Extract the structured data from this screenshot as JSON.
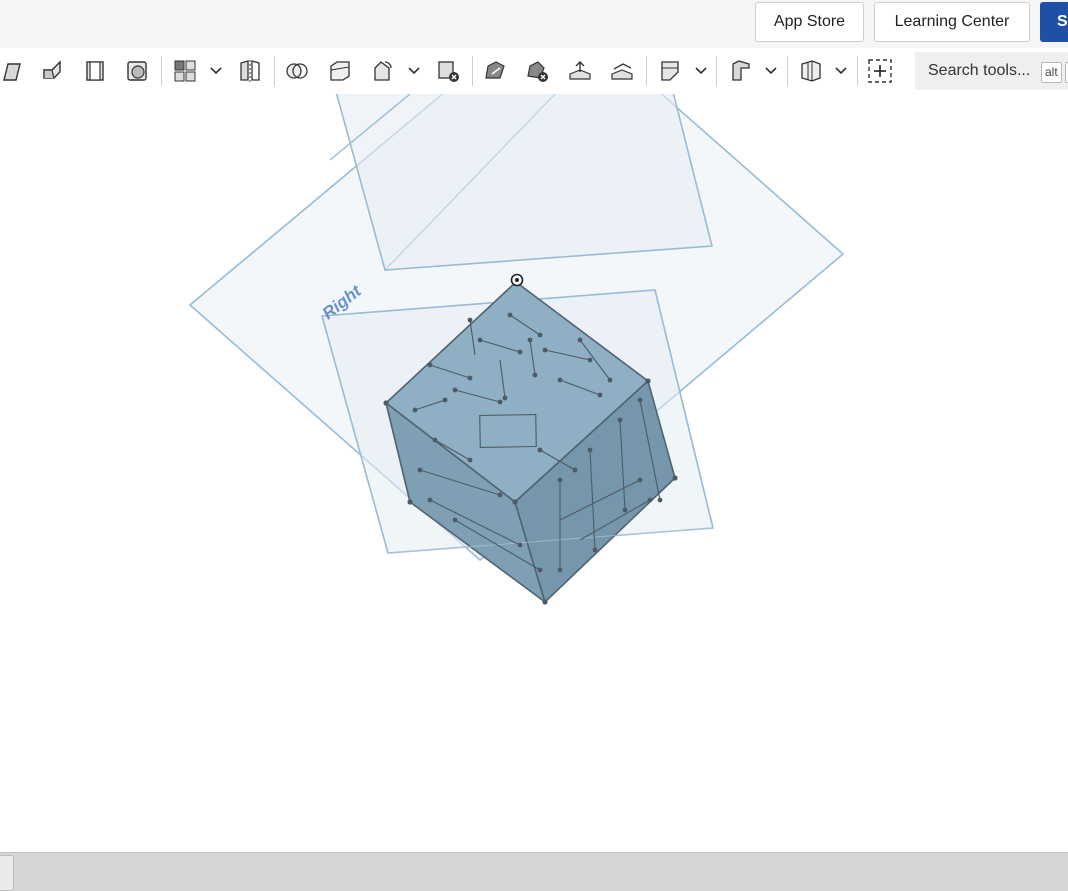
{
  "header": {
    "app_store_label": "App Store",
    "learning_center_label": "Learning Center",
    "primary_button_label": "S"
  },
  "toolbar": {
    "tools": [
      "extrude-icon",
      "revolve-icon",
      "sweep-icon",
      "loft-icon",
      "pattern-icon",
      "mirror-icon",
      "boolean-icon",
      "split-icon",
      "transform-icon",
      "delete-part-icon",
      "move-face-icon",
      "delete-face-icon",
      "offset-surface-icon",
      "plane-icon",
      "sheet-metal-icon",
      "frame-icon",
      "insert-icon"
    ],
    "search_placeholder": "Search tools...",
    "search_shortcut": "alt"
  },
  "viewport": {
    "plane_label": "Right",
    "plane_color": "#9bbad4",
    "part_color": "#7f9fb5"
  },
  "bottombar": {}
}
